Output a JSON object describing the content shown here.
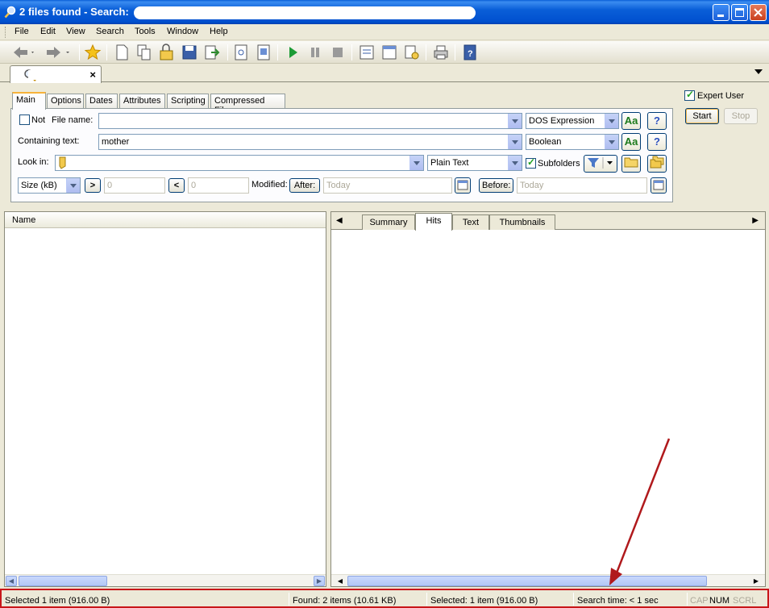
{
  "window": {
    "title": "2 files found - Search:"
  },
  "menu": [
    "File",
    "Edit",
    "View",
    "Search",
    "Tools",
    "Window",
    "Help"
  ],
  "doc_tab": {
    "close_label": "×"
  },
  "search_tabs": [
    "Main",
    "Options",
    "Dates",
    "Attributes",
    "Scripting",
    "Compressed Files"
  ],
  "form": {
    "not_label": "Not",
    "file_name_label": "File name:",
    "file_name_value": "",
    "file_name_mode": "DOS Expression",
    "containing_text_label": "Containing text:",
    "containing_text_value": "mother",
    "containing_text_mode": "Boolean",
    "look_in_label": "Look in:",
    "look_in_value": "",
    "look_in_mode": "Plain Text",
    "subfolders_label": "Subfolders",
    "size_unit": "Size (kB)",
    "gt_label": ">",
    "lt_label": "<",
    "size_min": "0",
    "size_max": "0",
    "modified_label": "Modified:",
    "after_label": "After:",
    "before_label": "Before:",
    "after_value": "Today",
    "before_value": "Today",
    "case_label": "Aa",
    "help_label": "?"
  },
  "side": {
    "expert_user_label": "Expert User",
    "start_label": "Start",
    "stop_label": "Stop"
  },
  "results": {
    "name_header": "Name"
  },
  "result_tabs": [
    "Summary",
    "Hits",
    "Text",
    "Thumbnails"
  ],
  "status": {
    "selected_left": "Selected 1 item (916.00 B)",
    "found": "Found: 2 items (10.61 KB)",
    "selected_right": "Selected: 1 item (916.00 B)",
    "search_time": "Search time: < 1 sec",
    "cap": "CAP",
    "num": "NUM",
    "scrl": "SCRL"
  },
  "colors": {
    "title_blue": "#0a5fd8",
    "highlight_red": "#c8171a",
    "tab_accent": "#f7b23a"
  }
}
